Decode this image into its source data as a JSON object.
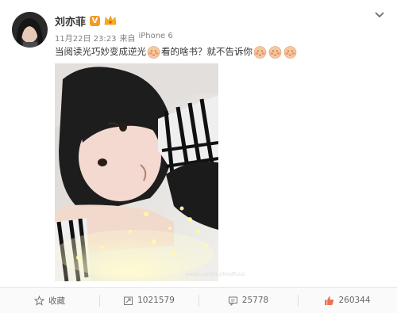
{
  "post": {
    "author_name": "刘亦菲",
    "verified_badge": "V",
    "timestamp": "11月22日 23:23",
    "source_prefix": "来自",
    "device": "iPhone 6",
    "text_part1": "当阅读光巧妙变成逆光",
    "text_part2": "看的啥书？就不告诉你",
    "watermark": "weibo.com/liuyifeiofficial"
  },
  "actions": {
    "favorite_label": "收藏",
    "repost_count": "1021579",
    "comment_count": "25778",
    "like_count": "260344"
  },
  "colors": {
    "verified": "#f29b26",
    "like_icon": "#eb7350",
    "meta_text": "#808080",
    "action_bar_bg": "#fafafa"
  },
  "icons": {
    "menu": "chevron-down-icon",
    "crown": "crown-icon",
    "emoji": "shy-face-emoji",
    "favorite": "star-icon",
    "repost": "repost-icon",
    "comment": "comment-icon",
    "like": "thumbs-up-icon"
  }
}
